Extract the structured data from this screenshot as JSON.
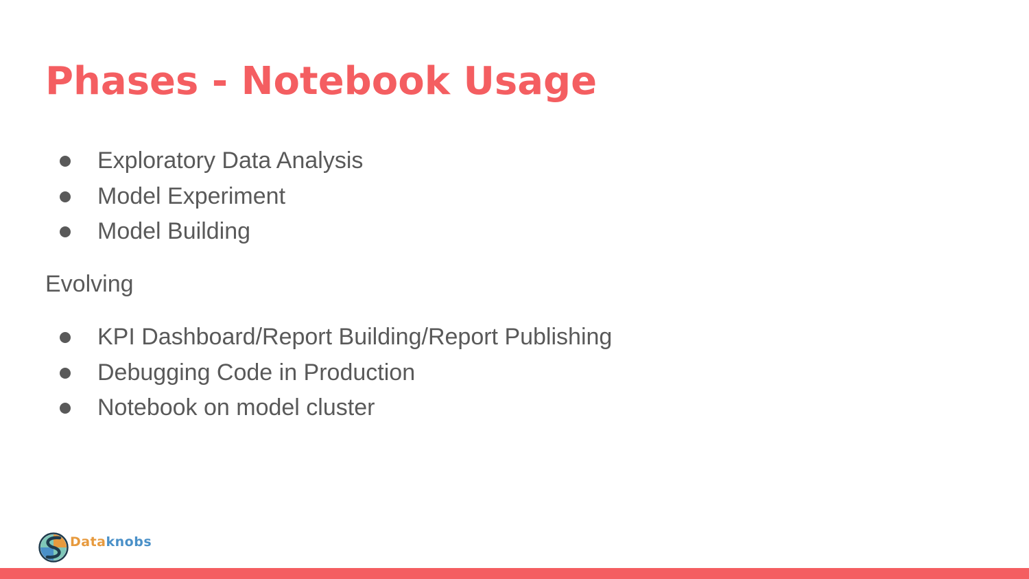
{
  "slide": {
    "title": "Phases - Notebook Usage",
    "bullets_primary": [
      "Exploratory Data Analysis",
      "Model Experiment",
      "Model Building"
    ],
    "section_label": "Evolving",
    "bullets_secondary": [
      "KPI Dashboard/Report Building/Report Publishing",
      "Debugging Code in Production",
      "Notebook on model cluster"
    ]
  },
  "brand": {
    "name_part1": "Data",
    "name_part2": "knobs",
    "logo_icon": "dataknobs-logo-icon",
    "colors": {
      "accent": "#f45e61",
      "text": "#595959",
      "brand_orange": "#e79a3e",
      "brand_blue": "#4a90c8",
      "brand_teal": "#7fc7b8",
      "brand_navy": "#1f3b4d"
    }
  }
}
